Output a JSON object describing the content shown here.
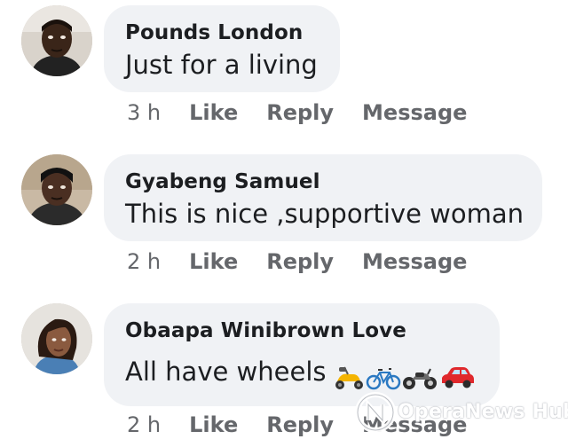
{
  "comments": [
    {
      "author": "Pounds London",
      "text": "Just for a living",
      "time": "3 h",
      "like": "Like",
      "reply": "Reply",
      "message": "Message"
    },
    {
      "author": "Gyabeng Samuel",
      "text": "This is nice ,supportive woman",
      "time": "2 h",
      "like": "Like",
      "reply": "Reply",
      "message": "Message"
    },
    {
      "author": "Obaapa Winibrown Love",
      "text": "All have wheels",
      "emojis": [
        "scooter-icon",
        "bicycle-icon",
        "motorcycle-icon",
        "car-icon"
      ],
      "time": "2 h",
      "like": "Like",
      "reply": "Reply",
      "message": "Message"
    }
  ],
  "watermark": {
    "brand": "OperaNews Hub"
  },
  "colors": {
    "bubble": "#f0f2f5",
    "text": "#1c1e21",
    "meta": "#65676b"
  }
}
